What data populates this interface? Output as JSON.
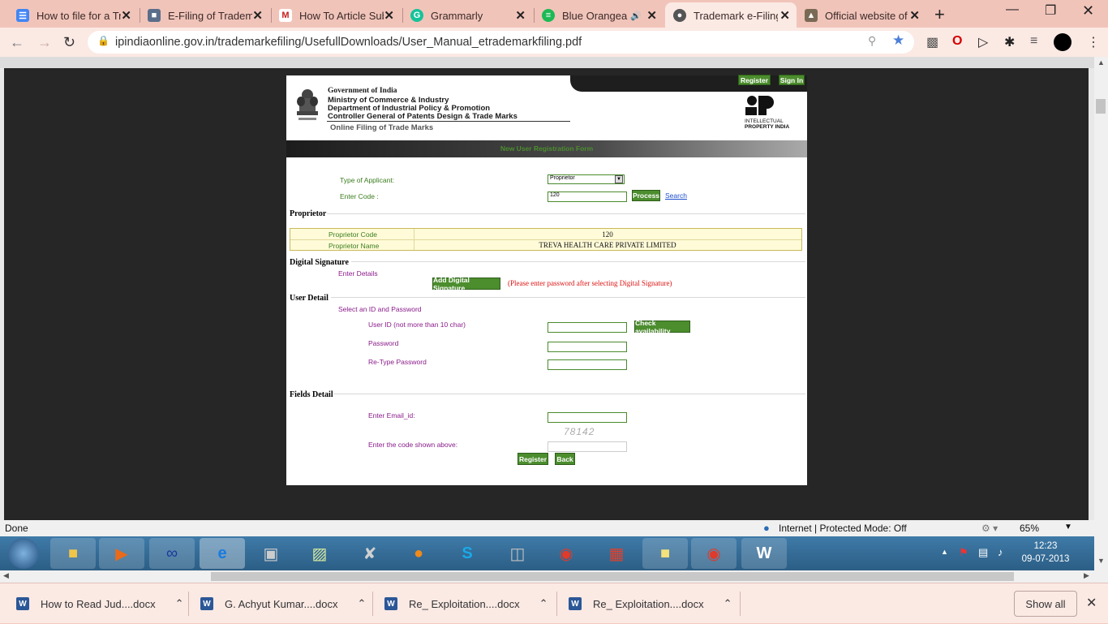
{
  "browser": {
    "tabs": [
      {
        "label": "How to file for a Tr",
        "icon": "docs-icon",
        "color": "#4285f4"
      },
      {
        "label": "E-Filing of Tradem",
        "icon": "site-icon",
        "color": "#5a6e8a"
      },
      {
        "label": "How To Article Sub",
        "icon": "gmail-icon",
        "color": "#c5221f"
      },
      {
        "label": "Grammarly",
        "icon": "grammarly-icon",
        "color": "#15c39a"
      },
      {
        "label": "Blue Orangea",
        "icon": "spotify-icon",
        "color": "#1db954"
      },
      {
        "label": "Trademark e-Filing",
        "icon": "chrome-icon",
        "color": "#555555"
      },
      {
        "label": "Official website of",
        "icon": "emblem-icon",
        "color": "#7a6a55"
      }
    ],
    "url": "ipindiaonline.gov.in/trademarkefiling/UsefullDownloads/User_Manual_etrademarkfiling.pdf"
  },
  "form": {
    "gov_line1": "Government of India",
    "gov_line2": "Ministry of Commerce & Industry",
    "gov_line3": "Department of Industrial Policy & Promotion",
    "gov_line4": "Controller General of Patents Design & Trade Marks",
    "gov_line5": "Online Filing of Trade Marks",
    "ip_logo_line1": "INTELLECTUAL",
    "ip_logo_line2": "PROPERTY INDIA",
    "register_top": "Register",
    "signin_top": "Sign In",
    "title": "New User Registration Form",
    "type_label": "Type of Applicant:",
    "type_value": "Proprietor",
    "code_label": "Enter Code :",
    "code_value": "120",
    "process_btn": "Process",
    "search_link": "Search",
    "proprietor_section": "Proprietor",
    "prop_code_label": "Proprietor Code",
    "prop_code_value": "120",
    "prop_name_label": "Proprietor Name",
    "prop_name_value": "TREVA HEALTH CARE PRIVATE LIMITED",
    "digsig_section": "Digital Signature",
    "enter_details": "Enter Details",
    "add_digsig_btn": "Add Digital Signature",
    "digsig_note": "(Please enter password after selecting Digital Signature)",
    "user_section": "User Detail",
    "select_id": "Select an ID and Password",
    "userid_label": "User ID (not more than 10 char)",
    "check_btn": "Check availability",
    "password_label": "Password",
    "retype_label": "Re-Type Password",
    "fields_section": "Fields Detail",
    "email_label": "Enter Email_id:",
    "captcha": "78142",
    "code_shown_label": "Enter the code shown above:",
    "register_btn": "Register",
    "back_btn": "Back"
  },
  "status": {
    "left": "Done",
    "zone": "Internet | Protected Mode: Off",
    "zoom": "65%",
    "time": "12:23",
    "date": "09-07-2013"
  },
  "downloads": {
    "items": [
      "How to Read Jud....docx",
      "G. Achyut Kumar....docx",
      "Re_ Exploitation....docx",
      "Re_ Exploitation....docx"
    ],
    "show_all": "Show all"
  }
}
